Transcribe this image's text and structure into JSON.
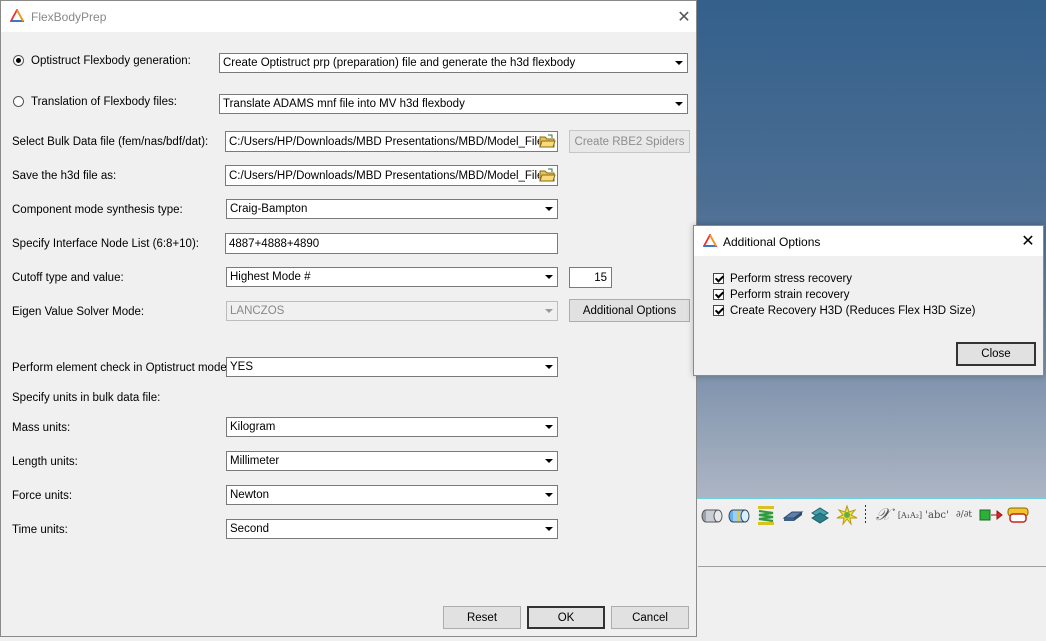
{
  "main": {
    "title": "FlexBodyPrep",
    "radio1_label": "Optistruct Flexbody generation:",
    "radio1_value": "Create Optistruct prp (preparation) file and generate the h3d flexbody",
    "radio2_label": "Translation of Flexbody files:",
    "radio2_value": "Translate ADAMS mnf file into MV h3d flexbody",
    "bulk_label": "Select Bulk Data file (fem/nas/bdf/dat):",
    "bulk_value": "C:/Users/HP/Downloads/MBD Presentations/MBD/Model_Files.",
    "rbe2_button": "Create RBE2 Spiders",
    "save_label": "Save the h3d file as:",
    "save_value": "C:/Users/HP/Downloads/MBD Presentations/MBD/Model_Files.",
    "cms_label": "Component mode synthesis type:",
    "cms_value": "Craig-Bampton",
    "interface_label": "Specify Interface Node List (6:8+10):",
    "interface_value": "4887+4888+4890",
    "cutoff_label": "Cutoff type and value:",
    "cutoff_type": "Highest Mode #",
    "cutoff_value": "15",
    "eigen_label": "Eigen Value Solver Mode:",
    "eigen_value": "LANCZOS",
    "additional_button": "Additional Options",
    "element_check_label": "Perform element check in Optistruct model:",
    "element_check_value": "YES",
    "units_heading": "Specify units in bulk data file:",
    "mass_label": "Mass units:",
    "mass_value": "Kilogram",
    "length_label": "Length units:",
    "length_value": "Millimeter",
    "force_label": "Force units:",
    "force_value": "Newton",
    "time_label": "Time units:",
    "time_value": "Second",
    "reset_button": "Reset",
    "ok_button": "OK",
    "cancel_button": "Cancel",
    "close_glyph": "✕"
  },
  "additional": {
    "title": "Additional Options",
    "options": [
      {
        "label": "Perform stress recovery",
        "checked": true
      },
      {
        "label": "Perform strain recovery",
        "checked": true
      },
      {
        "label": "Create Recovery H3D (Reduces Flex H3D Size)",
        "checked": true
      }
    ],
    "close_button": "Close",
    "close_glyph": "✕"
  },
  "toolbar": {
    "icons": [
      "cylinder-icon",
      "cylinder-bands-icon",
      "spring-icon",
      "beam-icon",
      "bushing-icon",
      "contact-icon",
      "separator",
      "variable-icon",
      "matrix-icon",
      "text-icon",
      "derivative-icon",
      "output-icon",
      "template-icon"
    ],
    "variable_glyph": "𝒳",
    "matrix_glyph": "[A₁A₂]",
    "text_glyph": "'abc'",
    "derivative_glyph": "∂/∂t"
  },
  "colors": {
    "accent_logo_red": "#e8322b",
    "accent_logo_orange": "#f29c1f",
    "accent_logo_blue": "#2a7ad5",
    "viewport_top": "#33608c",
    "viewport_bottom": "#aeb6c4"
  }
}
